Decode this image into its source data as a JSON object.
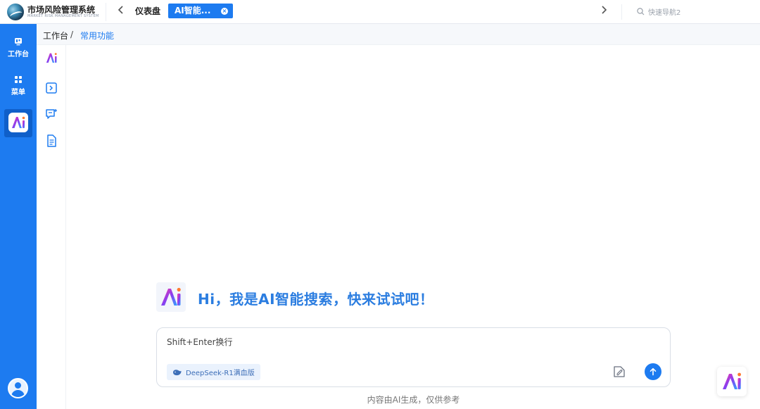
{
  "app": {
    "title": "市场风险管理系统",
    "subtitle": "MARKET RISK MANAGEMENT SYSTEM"
  },
  "tabs": {
    "prev_icon": "chevron-left-icon",
    "next_icon": "chevron-right-icon",
    "items": [
      {
        "label": "仪表盘",
        "active": false
      },
      {
        "label": "AI智能...",
        "active": true,
        "close": "×"
      }
    ]
  },
  "quick_nav": {
    "placeholder": "快速导航2",
    "icon": "search-icon"
  },
  "sidebar": {
    "items": [
      {
        "label": "工作台",
        "icon": "workbench-icon"
      },
      {
        "label": "菜单",
        "icon": "grid-menu-icon"
      },
      {
        "label": "",
        "icon": "ai-logo-icon",
        "active": true
      }
    ],
    "avatar_icon": "user-avatar-icon"
  },
  "breadcrumb": {
    "items": [
      "工作台",
      "常用功能"
    ],
    "separator": "/"
  },
  "tools": [
    "ai-logo-icon",
    "collapse-panel-icon",
    "new-chat-icon",
    "document-icon"
  ],
  "chat": {
    "greeting": "Hi，我是AI智能搜索，快来试试吧！",
    "input_placeholder": "Shift+Enter换行",
    "model_label": "DeepSeek-R1满血版",
    "attach_icon": "attach-file-icon",
    "send_icon": "arrow-up-icon",
    "disclaimer": "内容由AI生成，仅供参考"
  },
  "colors": {
    "primary": "#1d7bf0",
    "greeting": "#2b7de0",
    "background": "#ffffff"
  }
}
